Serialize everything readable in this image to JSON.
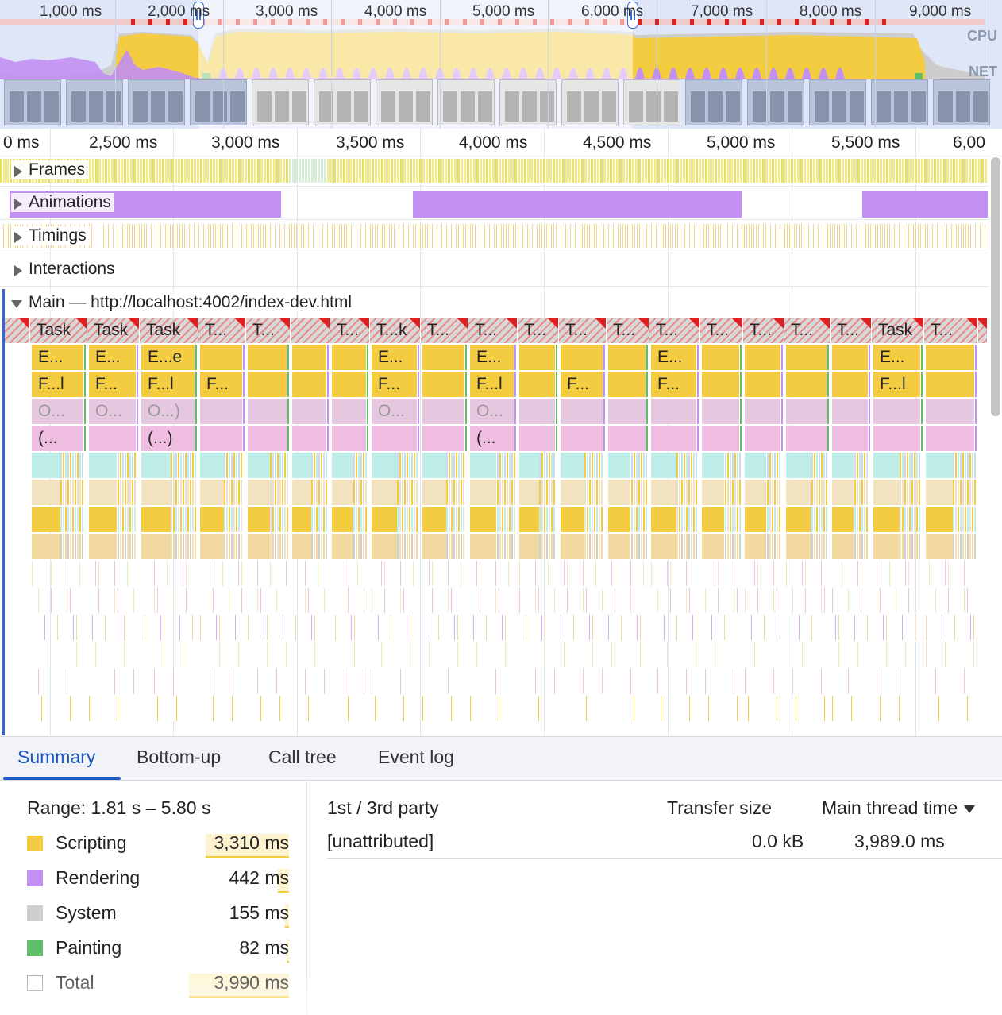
{
  "overview": {
    "ticks": [
      "1,000 ms",
      "2,000 ms",
      "3,000 ms",
      "4,000 ms",
      "5,000 ms",
      "6,000 ms",
      "7,000 ms",
      "8,000 ms",
      "9,000 ms"
    ],
    "cpu_label": "CPU",
    "net_label": "NET"
  },
  "ruler": {
    "ticks": [
      "0 ms",
      "2,500 ms",
      "3,000 ms",
      "3,500 ms",
      "4,000 ms",
      "4,500 ms",
      "5,000 ms",
      "5,500 ms",
      "6,00"
    ]
  },
  "tracks": {
    "frames": "Frames",
    "animations": "Animations",
    "timings": "Timings",
    "interactions": "Interactions",
    "main": "Main — http://localhost:4002/index-dev.html"
  },
  "flame": {
    "tasks": [
      "Task",
      "Task",
      "Task",
      "T...",
      "T...",
      "",
      "T...",
      "T...k",
      "T...",
      "T...",
      "T...",
      "T...",
      "T...",
      "T...",
      "T...",
      "T...",
      "T...",
      "T...",
      "Task",
      "T..."
    ],
    "row2": [
      "E...",
      "E...",
      "E...e",
      "E...",
      "E...",
      "E...",
      "E...",
      "E..."
    ],
    "row3": [
      "F...l",
      "F...",
      "F...l",
      "F...",
      "F...",
      "F...l",
      "F...",
      "F...",
      "F...l"
    ],
    "row4": [
      "O...",
      "O...",
      "O...)",
      "O...",
      "O..."
    ],
    "row5": [
      "(...",
      "(...)",
      "(..."
    ]
  },
  "tabs": [
    "Summary",
    "Bottom-up",
    "Call tree",
    "Event log"
  ],
  "summary": {
    "range": "Range: 1.81 s – 5.80 s",
    "rows": [
      {
        "label": "Scripting",
        "value": "3,310 ms",
        "color": "#f3cc42"
      },
      {
        "label": "Rendering",
        "value": "442 ms",
        "color": "#c28ff2"
      },
      {
        "label": "System",
        "value": "155 ms",
        "color": "#cfcfcf"
      },
      {
        "label": "Painting",
        "value": "82 ms",
        "color": "#5fbe68"
      },
      {
        "label": "Total",
        "value": "3,990 ms",
        "color": "#ffffff"
      }
    ]
  },
  "party": {
    "col1": "1st / 3rd party",
    "col2": "Transfer size",
    "col3": "Main thread time",
    "row": {
      "name": "[unattributed]",
      "size": "0.0 kB",
      "time": "3,989.0 ms"
    }
  },
  "colors": {
    "scripting": "#f3cc42",
    "rendering": "#c28ff2",
    "painting": "#5fbe68",
    "system": "#cfcfcf",
    "accent": "#1a56c4",
    "task_marker": "#e02020"
  }
}
